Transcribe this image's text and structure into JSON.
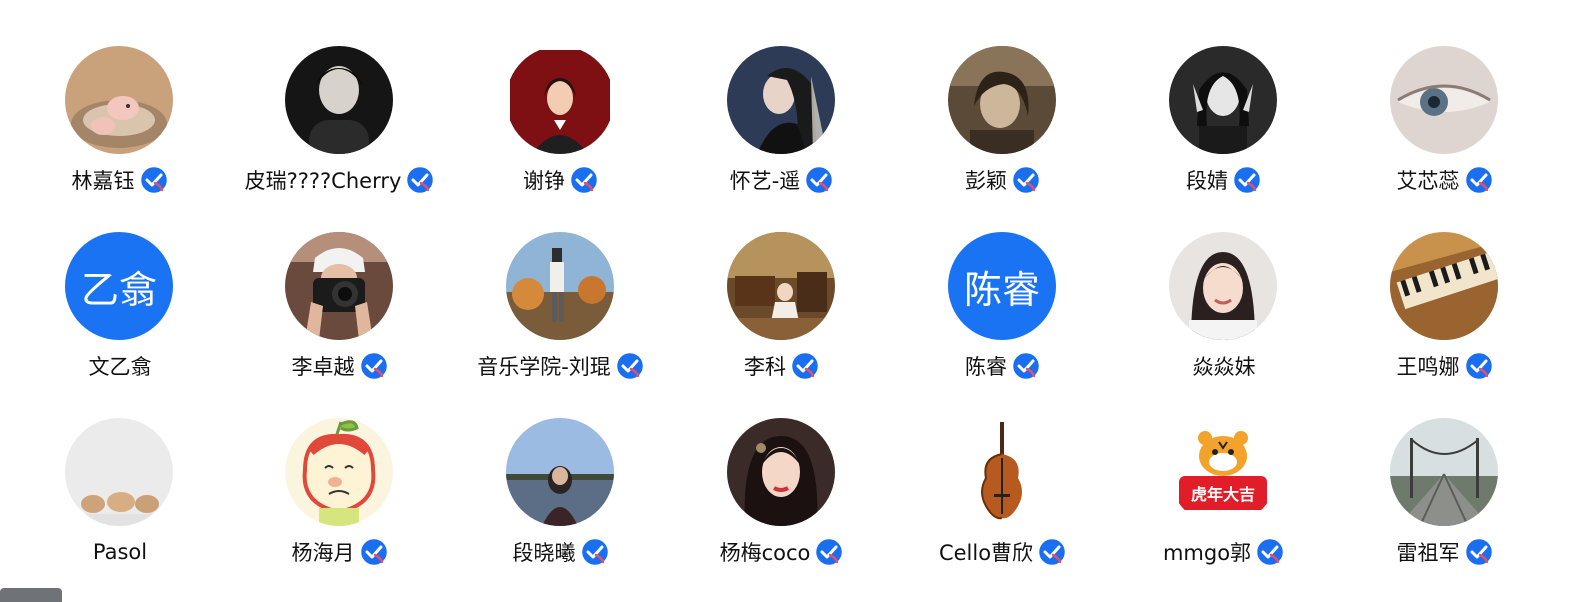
{
  "users": [
    {
      "name": "林嘉钰",
      "verified": true,
      "avatar": "pig-photo"
    },
    {
      "name": "皮瑞????Cherry",
      "verified": true,
      "avatar": "portrait-bw"
    },
    {
      "name": "谢铮",
      "verified": true,
      "avatar": "illustrated-woman"
    },
    {
      "name": "怀艺-遥",
      "verified": true,
      "avatar": "dark-portrait"
    },
    {
      "name": "彭颖",
      "verified": true,
      "avatar": "sepia-portrait"
    },
    {
      "name": "段婧",
      "verified": true,
      "avatar": "bw-portrait"
    },
    {
      "name": "艾芯蕊",
      "verified": true,
      "avatar": "eye-closeup"
    },
    {
      "name": "文乙翕",
      "verified": false,
      "avatar_text": "乙翕",
      "avatar": "text"
    },
    {
      "name": "李卓越",
      "verified": true,
      "avatar": "camera-photo"
    },
    {
      "name": "音乐学院-刘琨",
      "verified": true,
      "avatar": "autumn-scene"
    },
    {
      "name": "李科",
      "verified": true,
      "avatar": "room-painting"
    },
    {
      "name": "陈睿",
      "verified": true,
      "avatar_text": "陈睿",
      "avatar": "text"
    },
    {
      "name": "焱焱妹",
      "verified": false,
      "avatar": "girl-selfie"
    },
    {
      "name": "王鸣娜",
      "verified": true,
      "avatar": "piano-keys"
    },
    {
      "name": "Pasol",
      "verified": false,
      "avatar": "small-animals"
    },
    {
      "name": "杨海月",
      "verified": true,
      "avatar": "apple-cartoon"
    },
    {
      "name": "段晓曦",
      "verified": true,
      "avatar": "lake-scene"
    },
    {
      "name": "杨梅coco",
      "verified": true,
      "avatar": "woman-portrait"
    },
    {
      "name": "Cello曹欣",
      "verified": true,
      "avatar": "cello"
    },
    {
      "name": "mmgo郭",
      "verified": true,
      "avatar": "tiger-new-year",
      "avatar_caption": "虎年大吉"
    },
    {
      "name": "雷祖军",
      "verified": true,
      "avatar": "bridge"
    }
  ],
  "colors": {
    "badge": "#1a6ff0",
    "text_avatar": "#1a73f3"
  }
}
